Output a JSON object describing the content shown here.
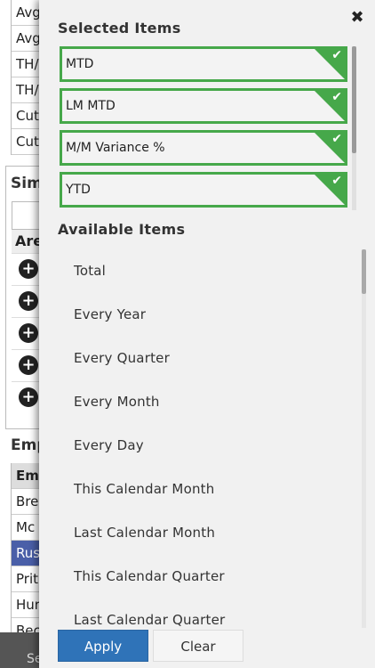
{
  "background": {
    "table_rows": [
      "Avg",
      "Avg",
      "TH/",
      "TH/",
      "Cut",
      "Cut"
    ],
    "sim_title": "Sim",
    "sim_header": "Are",
    "plus_icon_count": 5,
    "emp_title": "Emp",
    "emp_header": "Em",
    "emp_rows": [
      "Bre",
      "Mc",
      "Rus",
      "Prit",
      "Hur",
      "Bec"
    ],
    "bottom_text": "Se"
  },
  "panel": {
    "selected_title": "Selected Items",
    "selected_items": [
      "MTD",
      "LM MTD",
      "M/M Variance %",
      "YTD"
    ],
    "available_title": "Available Items",
    "available_items": [
      "Total",
      "Every Year",
      "Every Quarter",
      "Every Month",
      "Every Day",
      "This Calendar Month",
      "Last Calendar Month",
      "This Calendar Quarter",
      "Last Calendar Quarter"
    ],
    "apply_label": "Apply",
    "clear_label": "Clear",
    "close_symbol": "✖",
    "check_symbol": "✔"
  },
  "colors": {
    "selected_border": "#46a84a",
    "apply_bg": "#2f73b8",
    "selected_row_bg": "#4a5fa8"
  }
}
